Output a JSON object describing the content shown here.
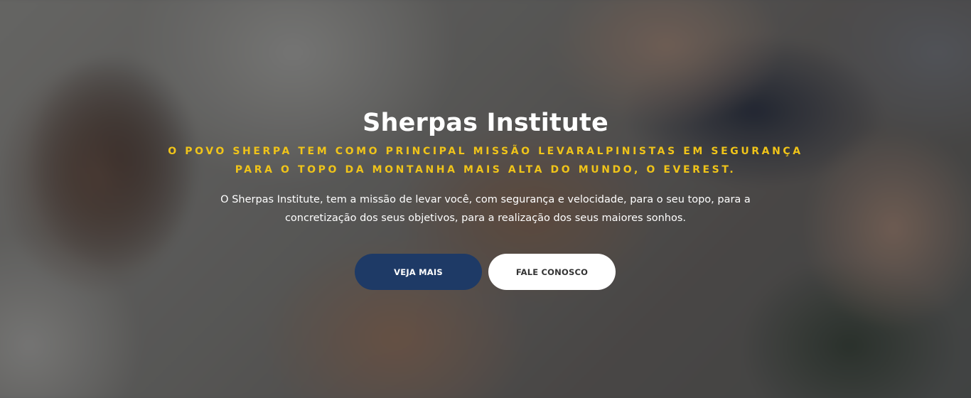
{
  "hero": {
    "title": "Sherpas Institute",
    "tagline_line1": "O povo Sherpa tem como principal missão levaralpinistas em segurança",
    "tagline_line2": "para o topo da montanha mais alta do mundo, o Everest.",
    "description_line1": "O Sherpas Institute, tem a missão de levar você, com segurança e velocidade, para o seu topo, para a",
    "description_line2": "concretização dos seus objetivos, para a realização dos seus maiores sonhos.",
    "primary_button_label": "VEJA MAIS",
    "secondary_button_label": "FALE CONOSCO"
  },
  "colors": {
    "tagline": "#f0c419",
    "primary_button": "#1e3a66",
    "secondary_button": "#ffffff",
    "overlay": "#181a1e"
  }
}
